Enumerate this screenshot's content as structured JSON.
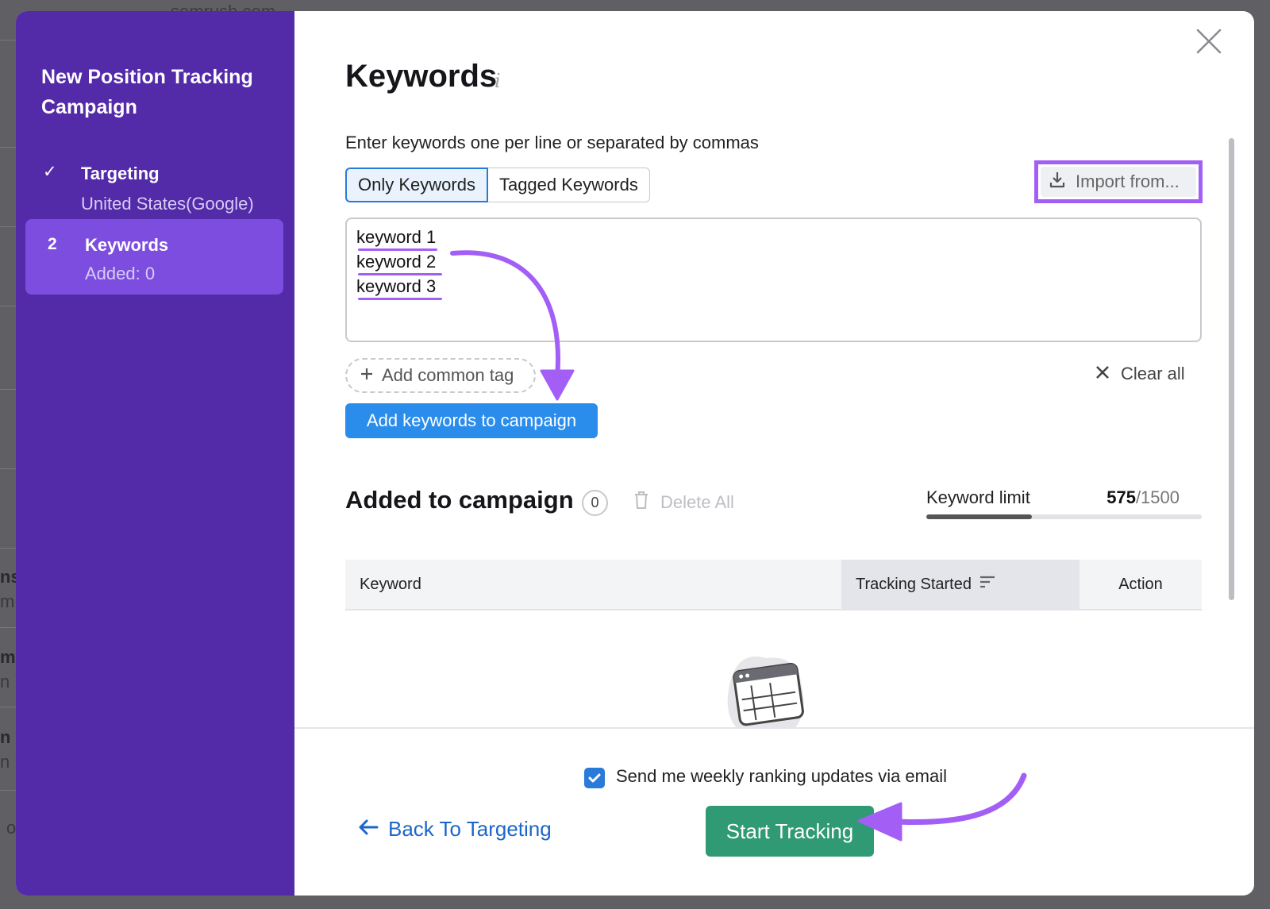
{
  "background": {
    "domain": "semrush.com",
    "fragments": [
      "ns",
      "m",
      "m",
      "n",
      "n",
      "n",
      "o"
    ]
  },
  "sidebar": {
    "title": "New Position Tracking Campaign",
    "steps": [
      {
        "marker": "✓",
        "name": "Targeting",
        "sub": "United States(Google)",
        "state": "done"
      },
      {
        "marker": "2",
        "name": "Keywords",
        "sub": "Added: 0",
        "state": "active"
      }
    ]
  },
  "main": {
    "heading": "Keywords",
    "info_icon": "i",
    "instructions": "Enter keywords one per line or separated by commas",
    "tabs": [
      "Only Keywords",
      "Tagged Keywords"
    ],
    "active_tab": "Only Keywords",
    "import_label": "Import from...",
    "keywords": [
      "keyword 1",
      "keyword 2",
      "keyword 3"
    ],
    "add_tag_label": "Add common tag",
    "clear_all_label": "Clear all",
    "add_button_label": "Add keywords to campaign"
  },
  "added": {
    "title": "Added to campaign",
    "count": "0",
    "delete_all_label": "Delete All",
    "limit_label": "Keyword limit",
    "limit_used": "575",
    "limit_total": "/1500",
    "limit_fraction": 0.383
  },
  "table": {
    "columns": [
      "Keyword",
      "Tracking Started",
      "Action"
    ]
  },
  "footer": {
    "email_label": "Send me weekly ranking updates via email",
    "email_checked": true,
    "back_label": "Back To Targeting",
    "start_label": "Start Tracking"
  },
  "colors": {
    "sidebar": "#532aa8",
    "active_step": "#7c4dde",
    "primary_blue": "#2a8ceb",
    "start_green": "#2f9a73",
    "annotation_purple": "#a35ff5",
    "link_blue": "#1d66c9"
  }
}
